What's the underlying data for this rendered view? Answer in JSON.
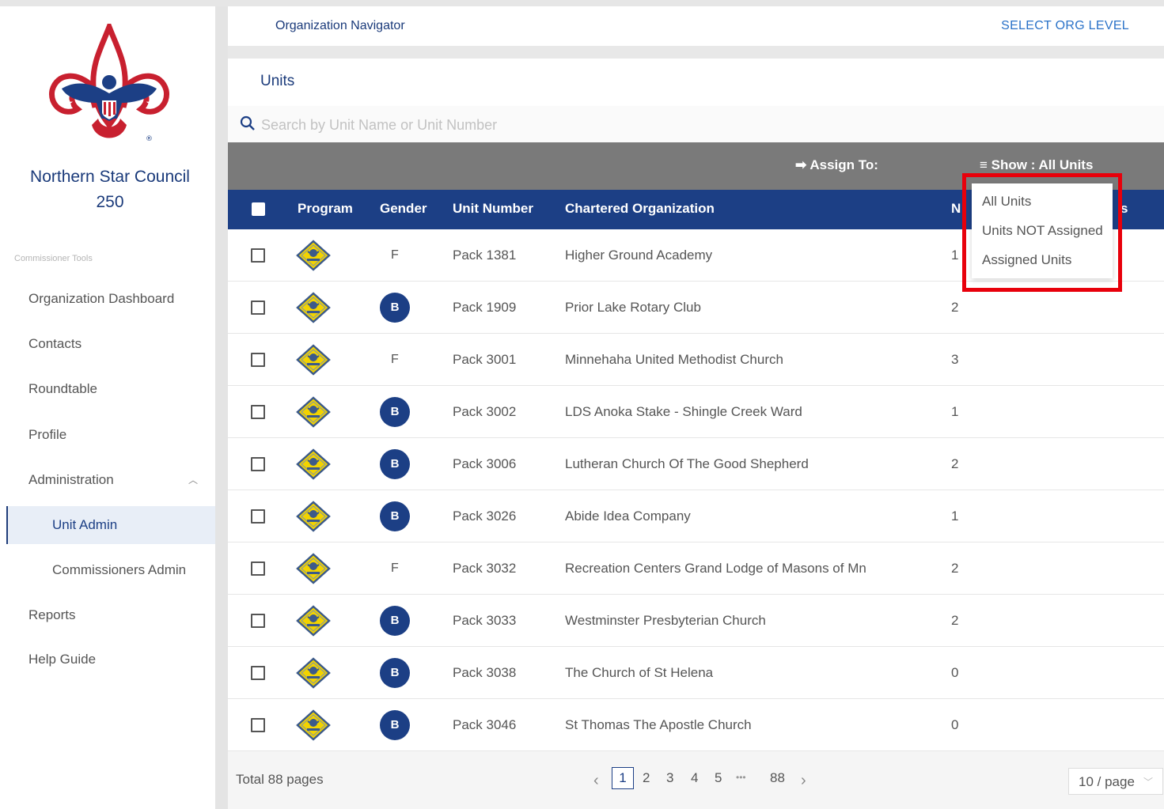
{
  "sidebar": {
    "council_name": "Northern Star Council",
    "council_number": "250",
    "section_label": "Commissioner Tools",
    "items": {
      "organization_dashboard": "Organization Dashboard",
      "contacts": "Contacts",
      "roundtable": "Roundtable",
      "profile": "Profile",
      "administration": "Administration",
      "unit_admin": "Unit Admin",
      "commissioners_admin": "Commissioners Admin",
      "reports": "Reports",
      "help_guide": "Help Guide"
    },
    "active_item": "Unit Admin"
  },
  "header": {
    "title": "Organization Navigator",
    "select_org_level": "SELECT ORG LEVEL"
  },
  "units": {
    "title": "Units",
    "search_placeholder": "Search by Unit Name or Unit Number",
    "assign_to": "Assign To:",
    "show_filter": "Show : All Units",
    "columns": {
      "program": "Program",
      "gender": "Gender",
      "unit_number": "Unit Number",
      "chartered_org": "Chartered Organization",
      "partial_left": "N",
      "partial_right": "s"
    },
    "dropdown": [
      "All Units",
      "Units NOT Assigned",
      "Assigned Units"
    ],
    "rows": [
      {
        "gender": "F",
        "unit": "Pack 1381",
        "org": "Higher Ground Academy",
        "count": "1"
      },
      {
        "gender": "B",
        "unit": "Pack 1909",
        "org": "Prior Lake Rotary Club",
        "count": "2"
      },
      {
        "gender": "F",
        "unit": "Pack 3001",
        "org": "Minnehaha United Methodist Church",
        "count": "3"
      },
      {
        "gender": "B",
        "unit": "Pack 3002",
        "org": "LDS Anoka Stake - Shingle Creek Ward",
        "count": "1"
      },
      {
        "gender": "B",
        "unit": "Pack 3006",
        "org": "Lutheran Church Of The Good Shepherd",
        "count": "2"
      },
      {
        "gender": "B",
        "unit": "Pack 3026",
        "org": "Abide Idea Company",
        "count": "1"
      },
      {
        "gender": "F",
        "unit": "Pack 3032",
        "org": "Recreation Centers Grand Lodge of Masons of Mn",
        "count": "2"
      },
      {
        "gender": "B",
        "unit": "Pack 3033",
        "org": "Westminster Presbyterian Church",
        "count": "2"
      },
      {
        "gender": "B",
        "unit": "Pack 3038",
        "org": "The Church of St Helena",
        "count": "0"
      },
      {
        "gender": "B",
        "unit": "Pack 3046",
        "org": "St Thomas The Apostle Church",
        "count": "0"
      }
    ]
  },
  "pagination": {
    "total": "Total 88 pages",
    "pages": [
      "1",
      "2",
      "3",
      "4",
      "5"
    ],
    "ellipsis": "•••",
    "last": "88",
    "current": "1",
    "per_page": "10 / page"
  },
  "colors": {
    "primary_navy": "#1c3f85",
    "action_bar": "#7a7a7a",
    "highlight": "#e8000b",
    "link_blue": "#2a72c8"
  },
  "icons": {
    "program": "cub-scout-diamond-icon",
    "search": "search-icon",
    "assign": "arrow-right-icon",
    "filter": "filter-icon"
  }
}
